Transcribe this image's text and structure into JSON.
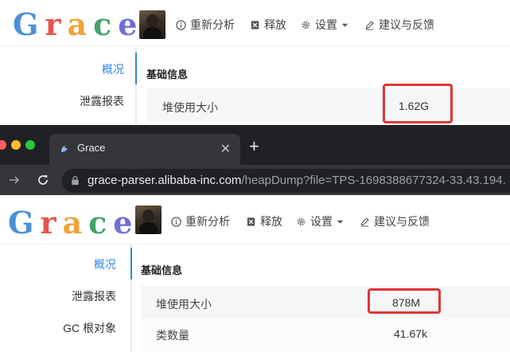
{
  "app": {
    "logo_text": "Grace",
    "logo_letters": [
      "G",
      "r",
      "a",
      "c",
      "e"
    ],
    "nav": {
      "reanalyze": "重新分析",
      "release": "释放",
      "settings": "设置",
      "feedback": "建议与反馈"
    },
    "sidebar": {
      "overview": "概况",
      "leak_report": "泄露报表",
      "gc_roots": "GC 根对象"
    },
    "section_title": "基础信息",
    "rows": {
      "heap_used_label": "堆使用大小",
      "class_count_label": "类数量"
    }
  },
  "top_panel": {
    "heap_used_value": "1.62G"
  },
  "bottom_panel": {
    "heap_used_value": "878M",
    "class_count_value": "41.67k"
  },
  "browser": {
    "tab_title": "Grace",
    "close_symbol": "✕",
    "new_tab_symbol": "+",
    "url_host": "grace-parser.alibaba-inc.com",
    "url_path": "/heapDump?file=TPS-1698388677324-33.43.194."
  },
  "colors": {
    "accent": "#2f86e8",
    "highlight": "#e23636",
    "chrome_dark": "#202124",
    "chrome_tab": "#35363a"
  }
}
